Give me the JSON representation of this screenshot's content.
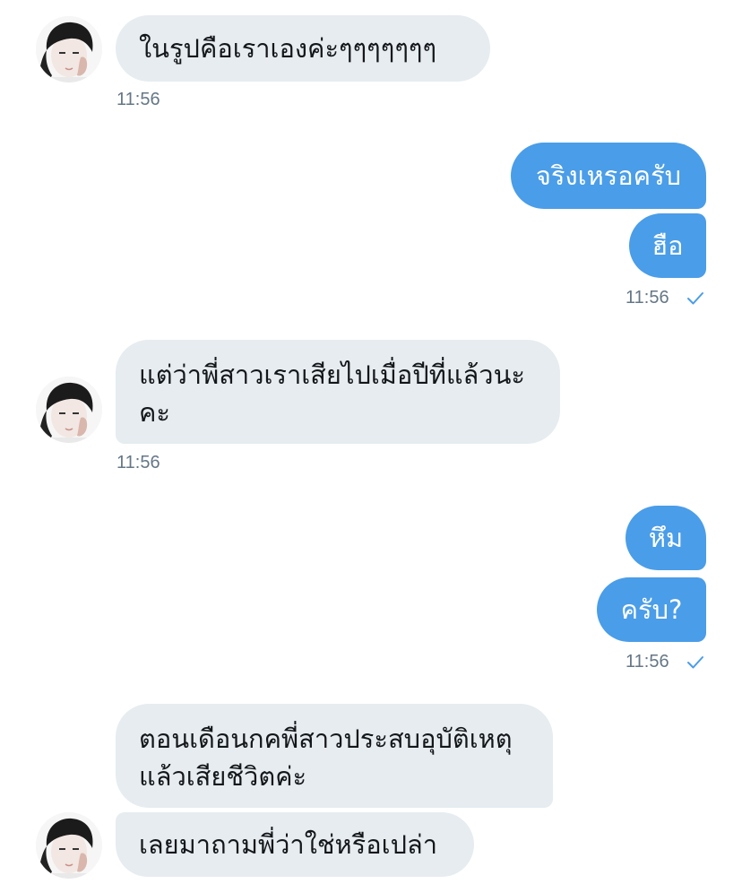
{
  "colors": {
    "incoming_bubble": "#e6ecf0",
    "outgoing_bubble": "#4a9de8",
    "timestamp": "#657786",
    "read_check": "#4a9de8"
  },
  "messages": [
    {
      "id": "m1",
      "direction": "incoming",
      "text": "ในรูปคือเราเองค่ะๆๆๆๆๆๆๆ"
    },
    {
      "id": "m1_time",
      "timestamp": "11:56"
    },
    {
      "id": "m2",
      "direction": "outgoing",
      "text": "จริงเหรอครับ"
    },
    {
      "id": "m3",
      "direction": "outgoing",
      "text": "ฮือ"
    },
    {
      "id": "m3_time",
      "timestamp": "11:56",
      "status_icon": "check-icon"
    },
    {
      "id": "m4",
      "direction": "incoming",
      "lines": [
        "แต่ว่าพี่สาวเราเสียไปเมื่อปีที่แล้วนะ",
        "คะ"
      ]
    },
    {
      "id": "m4_time",
      "timestamp": "11:56"
    },
    {
      "id": "m5",
      "direction": "outgoing",
      "text": "หึม"
    },
    {
      "id": "m6",
      "direction": "outgoing",
      "text": "ครับ?"
    },
    {
      "id": "m6_time",
      "timestamp": "11:56",
      "status_icon": "check-icon"
    },
    {
      "id": "m7",
      "direction": "incoming",
      "lines": [
        "ตอนเดือนกคพี่สาวประสบอุบัติเหตุ",
        "แล้วเสียชีวิตค่ะ"
      ]
    },
    {
      "id": "m8",
      "direction": "incoming",
      "text": "เลยมาถามพี่ว่าใช่หรือเปล่า"
    }
  ]
}
